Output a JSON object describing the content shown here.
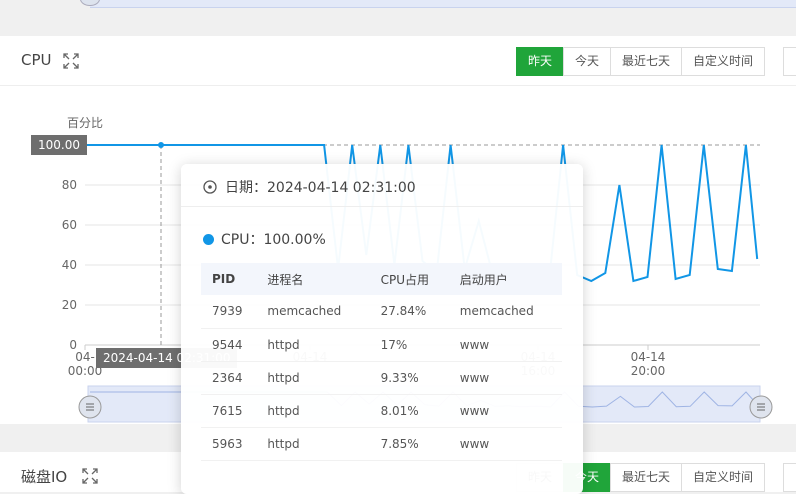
{
  "cpu_panel": {
    "title": "CPU",
    "icon": "expand-icon",
    "buttons": [
      "昨天",
      "今天",
      "最近七天",
      "自定义时间"
    ],
    "active_button": "昨天"
  },
  "disk_panel": {
    "title": "磁盘IO",
    "icon": "expand-icon",
    "buttons": [
      "昨天",
      "今天",
      "最近七天",
      "自定义时间"
    ],
    "active_button": "今天"
  },
  "chart_data": {
    "type": "line",
    "ylabel": "百分比",
    "y_ticks": [
      "0",
      "20",
      "40",
      "60",
      "80"
    ],
    "ylim": [
      0,
      100
    ],
    "x_ticks": [
      {
        "line1": "04-",
        "line2": "00:00"
      },
      {
        "line1": "04-14",
        "line2": ""
      },
      {
        "line1": "04-14",
        "line2": "16:00"
      },
      {
        "line1": "04-14",
        "line2": "20:00"
      }
    ],
    "pointer_y_label": "100.00",
    "pointer_x_label": "2024-04-14 02:31:00",
    "grid": true,
    "series_color": "#1196e6",
    "series": [
      {
        "name": "CPU",
        "x_hours": [
          0,
          0.3,
          0.6,
          0.9,
          1.2,
          1.5,
          1.8,
          2.1,
          2.52,
          3,
          3.5,
          4,
          4.5,
          5,
          5.5,
          6,
          6.5,
          7,
          7.5,
          8,
          8.5,
          9,
          9.5,
          10,
          10.5,
          11,
          11.5,
          12,
          12.5,
          13,
          13.5,
          14,
          14.5,
          15,
          15.5,
          16,
          16.5,
          17,
          17.5,
          18,
          18.5,
          19,
          19.5,
          20,
          20.5,
          21,
          21.5,
          22,
          22.5,
          23,
          23.5,
          23.9
        ],
        "values": [
          100,
          100,
          100,
          100,
          100,
          100,
          100,
          100,
          100,
          100,
          100,
          100,
          100,
          100,
          100,
          100,
          100,
          100,
          100,
          100,
          100,
          38,
          100,
          45,
          100,
          40,
          100,
          42,
          36,
          100,
          38,
          62,
          35,
          37,
          33,
          36,
          32,
          100,
          35,
          32,
          36,
          80,
          32,
          34,
          100,
          33,
          35,
          100,
          38,
          37,
          100,
          43
        ]
      }
    ]
  },
  "tooltip": {
    "date_label": "日期：2024-04-14 02:31:00",
    "series_label": "CPU：100.00%",
    "columns": [
      "PID",
      "进程名",
      "CPU占用",
      "启动用户"
    ],
    "rows": [
      [
        "7939",
        "memcached",
        "27.84%",
        "memcached"
      ],
      [
        "9544",
        "httpd",
        "17%",
        "www"
      ],
      [
        "2364",
        "httpd",
        "9.33%",
        "www"
      ],
      [
        "7615",
        "httpd",
        "8.01%",
        "www"
      ],
      [
        "5963",
        "httpd",
        "7.85%",
        "www"
      ]
    ]
  }
}
